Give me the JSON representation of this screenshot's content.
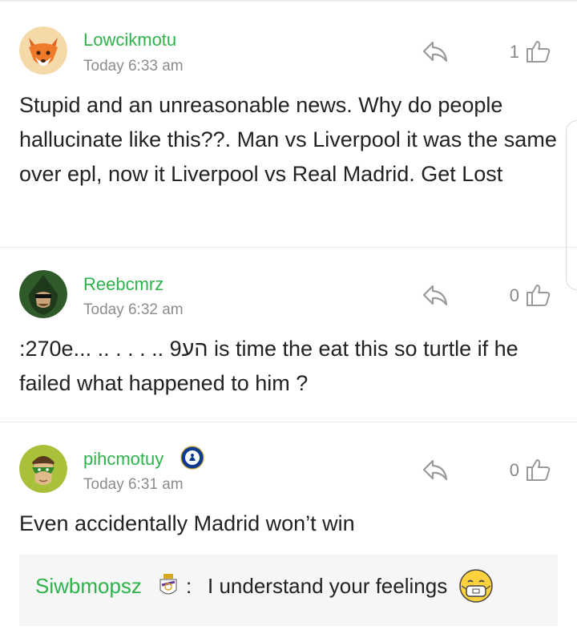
{
  "comments": [
    {
      "username": "Lowcikmotu",
      "timestamp": "Today 6:33 am",
      "likes": "1",
      "text": "Stupid and an unreasonable news. Why do people hallucinate like this??. Man vs Liverpool it was the same over epl, now it Liverpool vs Real Madrid. Get Lost",
      "avatar": "fox-avatar-icon"
    },
    {
      "username": "Reebcmrz",
      "timestamp": "Today 6:32 am",
      "likes": "0",
      "text": ":270e... .. . . . .. הע9 is time the eat this so turtle if he failed what happened to him ?",
      "avatar": "hooded-archer-avatar-icon"
    },
    {
      "username": "pihcmotuy",
      "timestamp": "Today 6:31 am",
      "likes": "0",
      "text": "Even accidentally Madrid won’t win",
      "avatar": "green-lantern-avatar-icon",
      "badge": "chelsea-crest-icon"
    }
  ],
  "reply": {
    "username": "Siwbmopsz",
    "separator": ":",
    "text": "I understand your feelings",
    "badge": "real-madrid-crest-icon",
    "emoji": "masked-face-emoji-icon"
  },
  "colors": {
    "username_green": "#2db34a",
    "timestamp_gray": "#8c8c8c",
    "icon_gray": "#9a9a9a",
    "reply_box_bg": "#f6f6f6"
  }
}
